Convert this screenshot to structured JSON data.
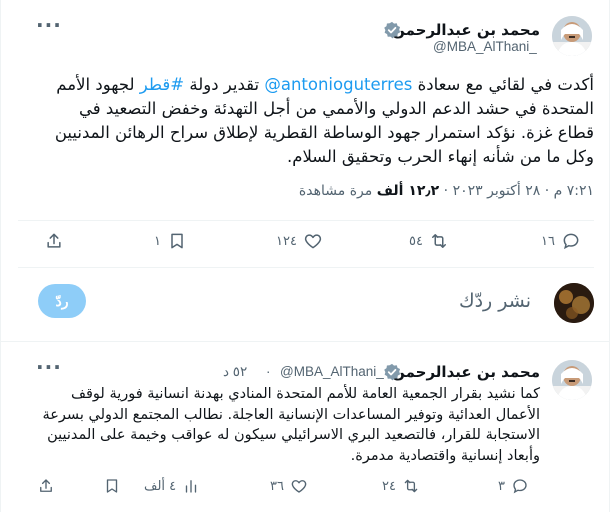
{
  "tweet": {
    "author_name": "محمد بن عبدالرحمن",
    "author_handle": "@MBA_AlThani_",
    "text_lines": {
      "line1_pre": "أكدت في لقائي مع سعادة ",
      "mention": "@antonioguterres",
      "line1_mid": " تقدير دولة ",
      "hashtag": "#قطر",
      "line1_post": " لجهود الأمم",
      "line2": "المتحدة في حشد الدعم الدولي والأممي من أجل التهدئة وخفض التصعيد في",
      "line3": "قطاع غزة. نؤكد استمرار جهود الوساطة القطرية لإطلاق سراح الرهائن المدنيين",
      "line4": "وكل ما من شأنه إنهاء الحرب وتحقيق السلام."
    },
    "meta": {
      "time": "٧:٢١ م",
      "dot1": "·",
      "date": "٢٨ أكتوبر ٢٠٢٣",
      "dot2": "·",
      "views_count": "١٢٫٢ ألف",
      "views_label": "مرة مشاهدة"
    },
    "actions": {
      "reply_count": "١٦",
      "retweet_count": "٥٤",
      "like_count": "١٢٤",
      "bookmark_count": "١"
    }
  },
  "composer": {
    "placeholder": "نشر ردّك",
    "reply_button": "ردّ"
  },
  "tweet2": {
    "author_name": "محمد بن عبدالرحمن",
    "author_handle": "@MBA_AlThani_",
    "time_ago": "٥٢ د",
    "dot": "·",
    "text_lines": {
      "line1": "كما نشيد بقرار الجمعية العامة للأمم المتحدة المنادي بهدنة انسانية فورية لوقف",
      "line2": "الأعمال العدائية وتوفير المساعدات الإنسانية العاجلة. نطالب المجتمع الدولي بسرعة",
      "line3": "الاستجابة للقرار، فالتصعيد البري الاسرائيلي سيكون له عواقب وخيمة على المدنيين",
      "line4": "وأبعاد إنسانية واقتصادية مدمرة."
    },
    "actions": {
      "reply_count": "٣",
      "retweet_count": "٢٤",
      "like_count": "٣٦",
      "views_count": "٤ ألف"
    }
  },
  "colors": {
    "link": "#1d9bf0",
    "muted": "#536471",
    "text": "#0f1419",
    "badge": "#829aab",
    "reply_button_disabled": "#8ecdf8",
    "divider": "#eff3f4"
  },
  "icons": {
    "more": "more-horizontal-icon",
    "verified": "verified-badge-icon",
    "reply": "reply-icon",
    "retweet": "retweet-icon",
    "like": "heart-icon",
    "bookmark": "bookmark-icon",
    "share": "share-icon",
    "views": "views-chart-icon"
  }
}
